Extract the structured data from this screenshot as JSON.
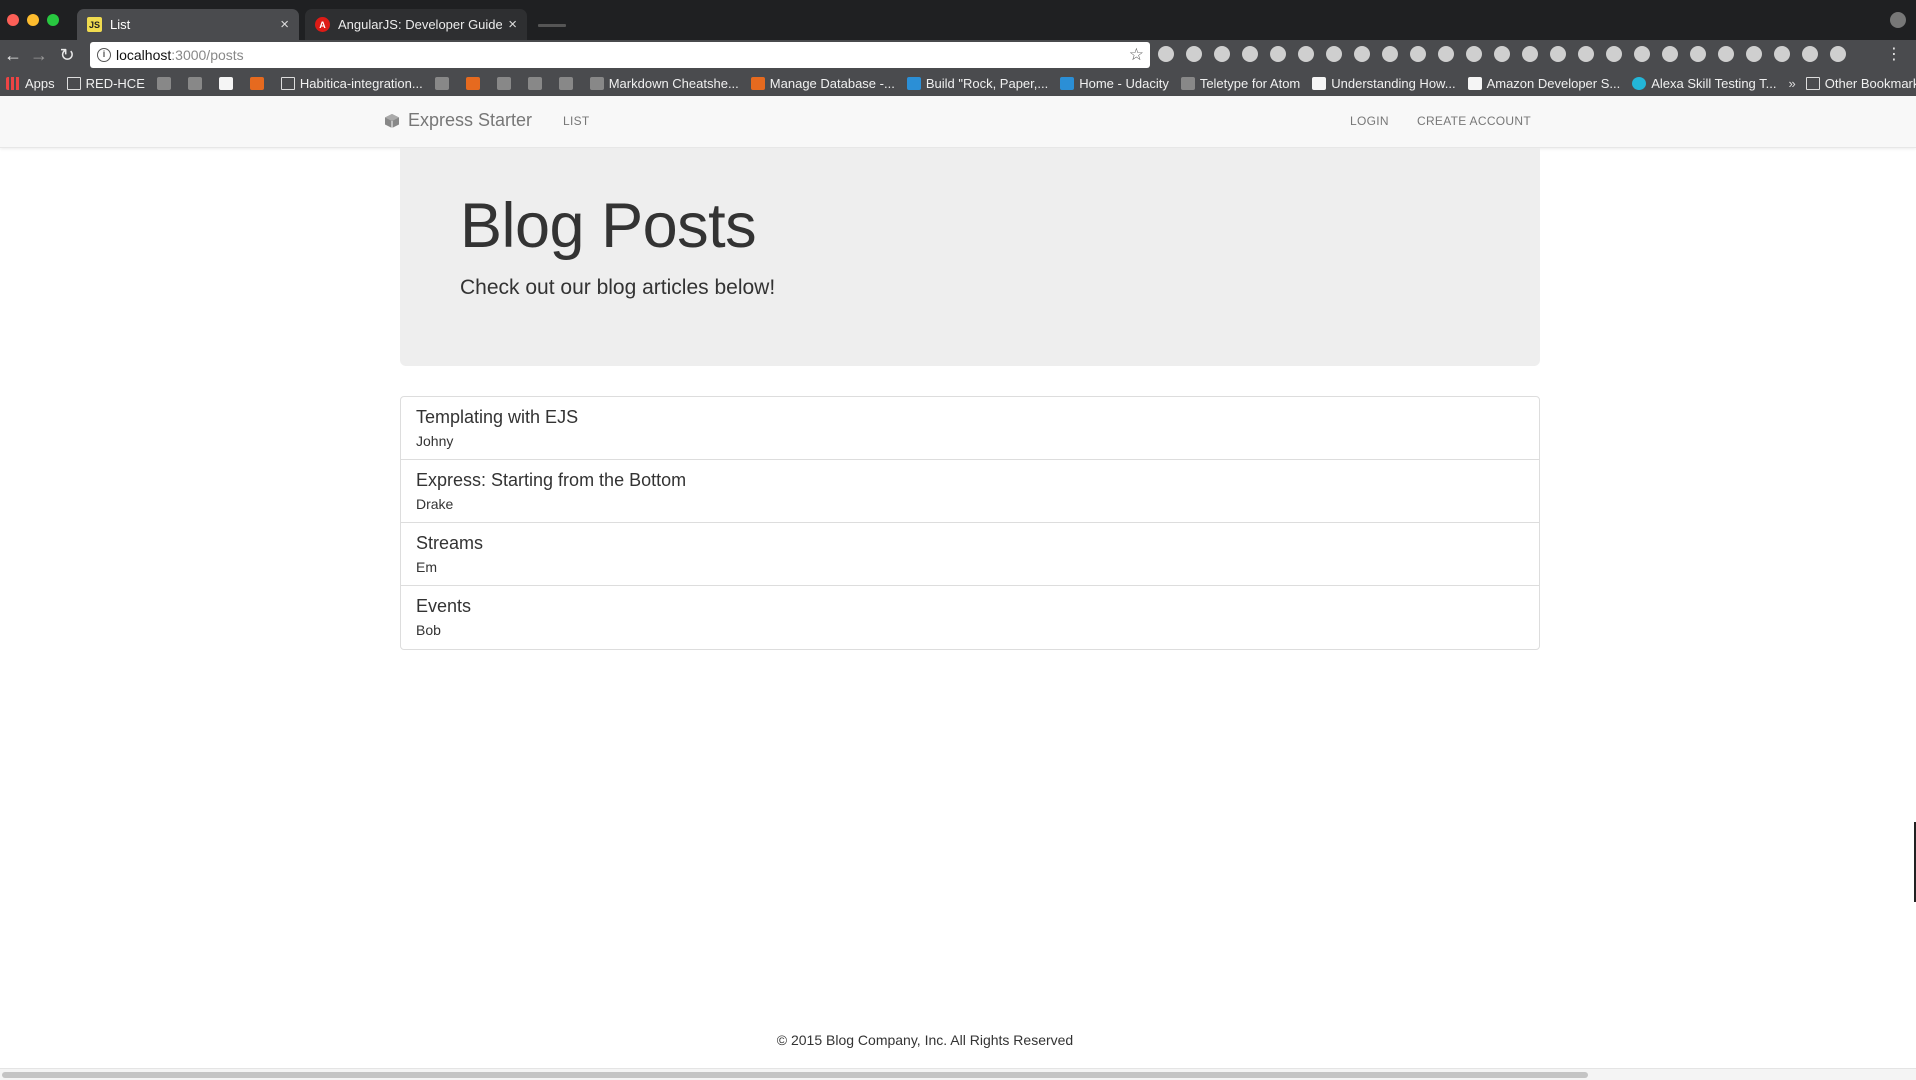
{
  "browser": {
    "tabs": [
      {
        "title": "List",
        "favicon": "js-icon",
        "active": true
      },
      {
        "title": "AngularJS: Developer Guide: F",
        "favicon": "angular-icon",
        "active": false
      }
    ],
    "address": {
      "host": "localhost",
      "path": ":3000/posts"
    },
    "bookmarks": [
      {
        "label": "Apps",
        "icon": "apps-icon",
        "style": "bm-apps"
      },
      {
        "label": "RED-HCE",
        "icon": "folder-icon",
        "style": "bm-folder"
      },
      {
        "label": "",
        "icon": "github-icon",
        "style": "bm-dot"
      },
      {
        "label": "",
        "icon": "circle-icon",
        "style": "bm-dot"
      },
      {
        "label": "",
        "icon": "lock-icon",
        "style": "bm-white"
      },
      {
        "label": "",
        "icon": "stack-icon",
        "style": "bm-orange"
      },
      {
        "label": "Habitica-integration...",
        "icon": "folder-icon",
        "style": "bm-folder"
      },
      {
        "label": "",
        "icon": "green-icon",
        "style": "bm-dot"
      },
      {
        "label": "",
        "icon": "r-icon",
        "style": "bm-orange"
      },
      {
        "label": "",
        "icon": "person-icon",
        "style": "bm-dot"
      },
      {
        "label": "",
        "icon": "person-icon",
        "style": "bm-dot"
      },
      {
        "label": "",
        "icon": "person-icon",
        "style": "bm-dot"
      },
      {
        "label": "Markdown Cheatshe...",
        "icon": "github-icon",
        "style": "bm-dot"
      },
      {
        "label": "Manage Database -...",
        "icon": "db-icon",
        "style": "bm-orange"
      },
      {
        "label": "Build \"Rock, Paper,...",
        "icon": "doc-icon",
        "style": "bm-blue"
      },
      {
        "label": "Home - Udacity",
        "icon": "udacity-icon",
        "style": "bm-blue"
      },
      {
        "label": "Teletype for Atom",
        "icon": "atom-icon",
        "style": "bm-dot"
      },
      {
        "label": "Understanding How...",
        "icon": "amazon-icon",
        "style": "bm-white"
      },
      {
        "label": "Amazon Developer S...",
        "icon": "amazon-icon",
        "style": "bm-white"
      },
      {
        "label": "Alexa Skill Testing T...",
        "icon": "alexa-icon",
        "style": "bm-teal"
      }
    ],
    "more_label": "»",
    "other_bookmarks": "Other Bookmarks"
  },
  "navbar": {
    "brand": "Express Starter",
    "list": "LIST",
    "login": "LOGIN",
    "create_account": "CREATE ACCOUNT"
  },
  "jumbotron": {
    "title": "Blog Posts",
    "subtitle": "Check out our blog articles below!"
  },
  "posts": [
    {
      "title": "Templating with EJS",
      "author": "Johny"
    },
    {
      "title": "Express: Starting from the Bottom",
      "author": "Drake"
    },
    {
      "title": "Streams",
      "author": "Em"
    },
    {
      "title": "Events",
      "author": "Bob"
    }
  ],
  "footer": "© 2015 Blog Company, Inc. All Rights Reserved"
}
